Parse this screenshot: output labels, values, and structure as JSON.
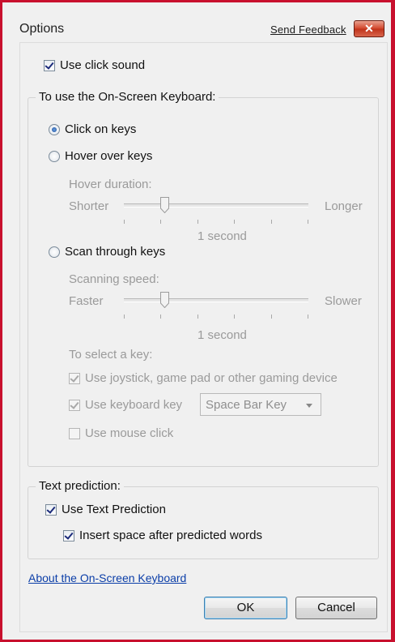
{
  "window": {
    "title": "Options",
    "feedback_link": "Send Feedback",
    "close_glyph": "✕"
  },
  "click_sound": {
    "label": "Use click sound",
    "checked": true
  },
  "osk_group": {
    "legend": "To use the On-Screen Keyboard:",
    "modes": [
      {
        "label": "Click on keys",
        "selected": true
      },
      {
        "label": "Hover over keys",
        "selected": false
      },
      {
        "label": "Scan through keys",
        "selected": false
      }
    ],
    "hover": {
      "heading": "Hover duration:",
      "min_label": "Shorter",
      "max_label": "Longer",
      "value_label": "1 second",
      "position_fraction": 0.22
    },
    "scan": {
      "heading": "Scanning speed:",
      "min_label": "Faster",
      "max_label": "Slower",
      "value_label": "1 second",
      "position_fraction": 0.22
    },
    "select_key": {
      "heading": "To select a key:",
      "joystick": {
        "label": "Use joystick, game pad or other gaming device",
        "checked": true
      },
      "keyboard_key": {
        "label": "Use keyboard key",
        "checked": true,
        "selected_key": "Space Bar Key"
      },
      "mouse_click": {
        "label": "Use mouse click",
        "checked": false
      }
    }
  },
  "text_prediction": {
    "legend": "Text prediction:",
    "use_prediction": {
      "label": "Use Text Prediction",
      "checked": true
    },
    "insert_space": {
      "label": "Insert space after predicted words",
      "checked": true
    }
  },
  "about_link": "About the On-Screen Keyboard",
  "buttons": {
    "ok": "OK",
    "cancel": "Cancel"
  },
  "colors": {
    "frame": "#c8102e",
    "link": "#0b3ea8",
    "disabled_text": "#9a9a9a"
  }
}
